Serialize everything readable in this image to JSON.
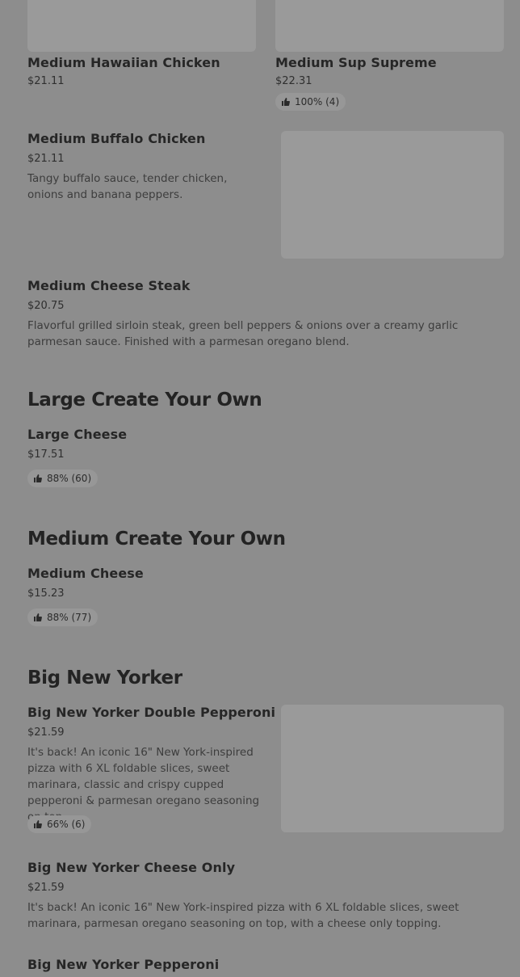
{
  "items": {
    "hawaiian": {
      "name": "Medium Hawaiian Chicken",
      "price": "$21.11"
    },
    "sup_supreme": {
      "name": "Medium Sup Supreme",
      "price": "$22.31",
      "rating": "100% (4)"
    },
    "buffalo": {
      "name": "Medium Buffalo Chicken",
      "price": "$21.11",
      "description": "Tangy buffalo sauce, tender chicken, onions and banana peppers."
    },
    "cheese_steak": {
      "name": "Medium Cheese Steak",
      "price": "$20.75",
      "description": "Flavorful grilled sirloin steak, green bell peppers & onions over a creamy garlic parmesan sauce. Finished with a parmesan oregano blend."
    },
    "large_cheese": {
      "name": "Large Cheese",
      "price": "$17.51",
      "rating": "88% (60)"
    },
    "medium_cheese": {
      "name": "Medium Cheese",
      "price": "$15.23",
      "rating": "88% (77)"
    },
    "bny_double_pep": {
      "name": "Big New Yorker Double Pepperoni",
      "price": "$21.59",
      "description": "It's back! An iconic 16\" New York-inspired pizza with 6 XL foldable slices, sweet marinara, classic and crispy cupped pepperoni & parmesan oregano seasoning on top.",
      "rating": "66% (6)"
    },
    "bny_cheese": {
      "name": "Big New Yorker Cheese Only",
      "price": "$21.59",
      "description": "It's back! An iconic 16\" New York-inspired pizza with 6 XL foldable slices, sweet marinara, parmesan oregano seasoning on top, with a cheese only topping."
    },
    "bny_pep": {
      "name": "Big New Yorker Pepperoni"
    }
  },
  "sections": {
    "large_create": "Large Create Your Own",
    "medium_create": "Medium Create Your Own",
    "big_new_yorker": "Big New Yorker"
  },
  "icons": {
    "rating": "thumbs-up-icon"
  },
  "colors": {
    "overlay": "#8d8d8d"
  }
}
